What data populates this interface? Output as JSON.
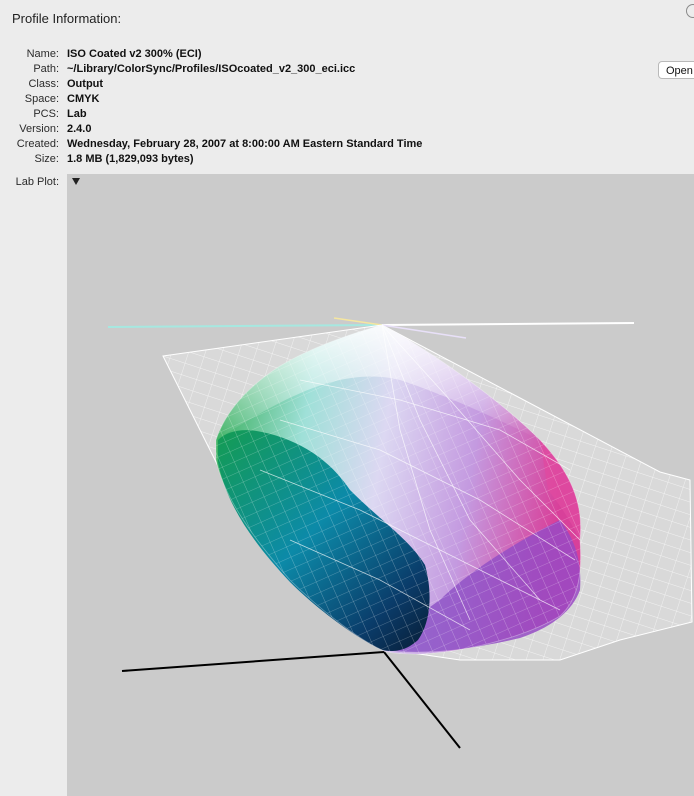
{
  "section": {
    "title": "Profile Information:"
  },
  "profile": {
    "rows": [
      {
        "label": "Name:",
        "value": "ISO Coated v2 300% (ECI)"
      },
      {
        "label": "Path:",
        "value": "~/Library/ColorSync/Profiles/ISOcoated_v2_300_eci.icc"
      },
      {
        "label": "Class:",
        "value": "Output"
      },
      {
        "label": "Space:",
        "value": "CMYK"
      },
      {
        "label": "PCS:",
        "value": "Lab"
      },
      {
        "label": "Version:",
        "value": "2.4.0"
      },
      {
        "label": "Created:",
        "value": "Wednesday, February 28, 2007 at 8:00:00 AM Eastern Standard Time"
      },
      {
        "label": "Size:",
        "value": "1.8 MB (1,829,093 bytes)"
      }
    ]
  },
  "buttons": {
    "open_label": "Open"
  },
  "plot": {
    "label": "Lab Plot:",
    "disclosure_icon": "triangle-down-icon",
    "colors": {
      "background": "#cbcbcb",
      "wireframe": "#ffffff",
      "axis": "#000000",
      "gamut_green": "#1a9a3c",
      "gamut_cyan": "#14a0c8",
      "gamut_magenta": "#d8409a",
      "gamut_purple": "#8a40c0",
      "gamut_white": "#f4f2fa"
    }
  }
}
